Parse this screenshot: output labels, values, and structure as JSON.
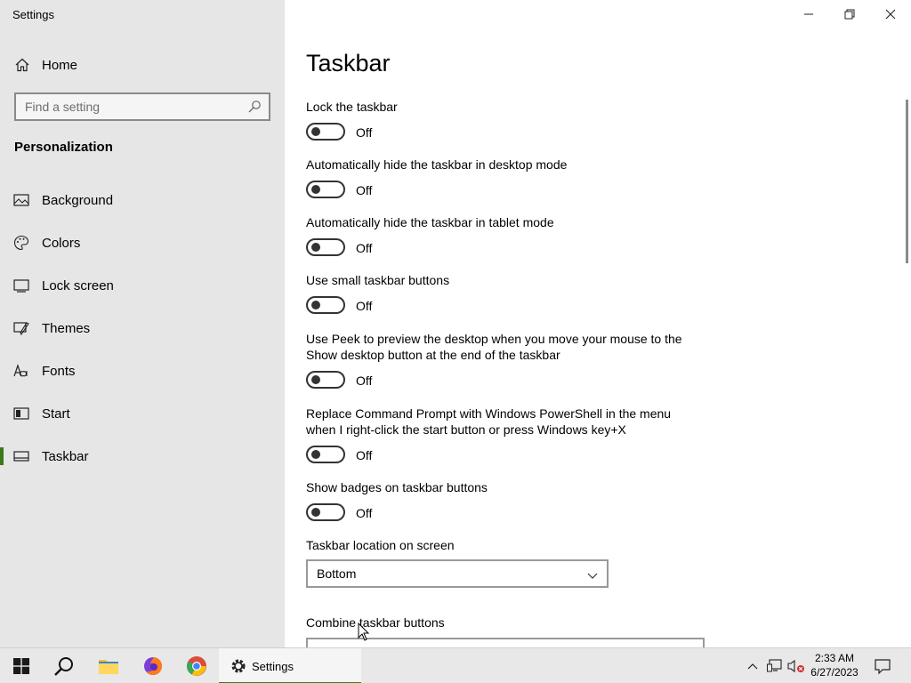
{
  "window": {
    "title": "Settings",
    "controls": {
      "minimize": "minimize",
      "restore": "restore",
      "close": "close"
    }
  },
  "sidebar": {
    "home_label": "Home",
    "search_placeholder": "Find a setting",
    "section_title": "Personalization",
    "items": [
      {
        "label": "Background",
        "icon": "picture-icon"
      },
      {
        "label": "Colors",
        "icon": "palette-icon"
      },
      {
        "label": "Lock screen",
        "icon": "lock-screen-icon"
      },
      {
        "label": "Themes",
        "icon": "themes-icon"
      },
      {
        "label": "Fonts",
        "icon": "fonts-icon"
      },
      {
        "label": "Start",
        "icon": "start-icon"
      },
      {
        "label": "Taskbar",
        "icon": "taskbar-icon",
        "active": true
      }
    ]
  },
  "main": {
    "title": "Taskbar",
    "settings": [
      {
        "label": "Lock the taskbar",
        "state": "Off"
      },
      {
        "label": "Automatically hide the taskbar in desktop mode",
        "state": "Off"
      },
      {
        "label": "Automatically hide the taskbar in tablet mode",
        "state": "Off"
      },
      {
        "label": "Use small taskbar buttons",
        "state": "Off"
      },
      {
        "label": "Use Peek to preview the desktop when you move your mouse to the Show desktop button at the end of the taskbar",
        "state": "Off"
      },
      {
        "label": "Replace Command Prompt with Windows PowerShell in the menu when I right-click the start button or press Windows key+X",
        "state": "Off"
      },
      {
        "label": "Show badges on taskbar buttons",
        "state": "Off"
      }
    ],
    "location_label": "Taskbar location on screen",
    "location_value": "Bottom",
    "combine_label": "Combine taskbar buttons"
  },
  "taskbar": {
    "settings_label": "Settings",
    "time": "2:33 AM",
    "date": "6/27/2023"
  },
  "colors": {
    "accent": "#3b7a1a",
    "sidebar_bg": "#e6e6e6",
    "taskbar_bg": "#e8e8e8"
  }
}
